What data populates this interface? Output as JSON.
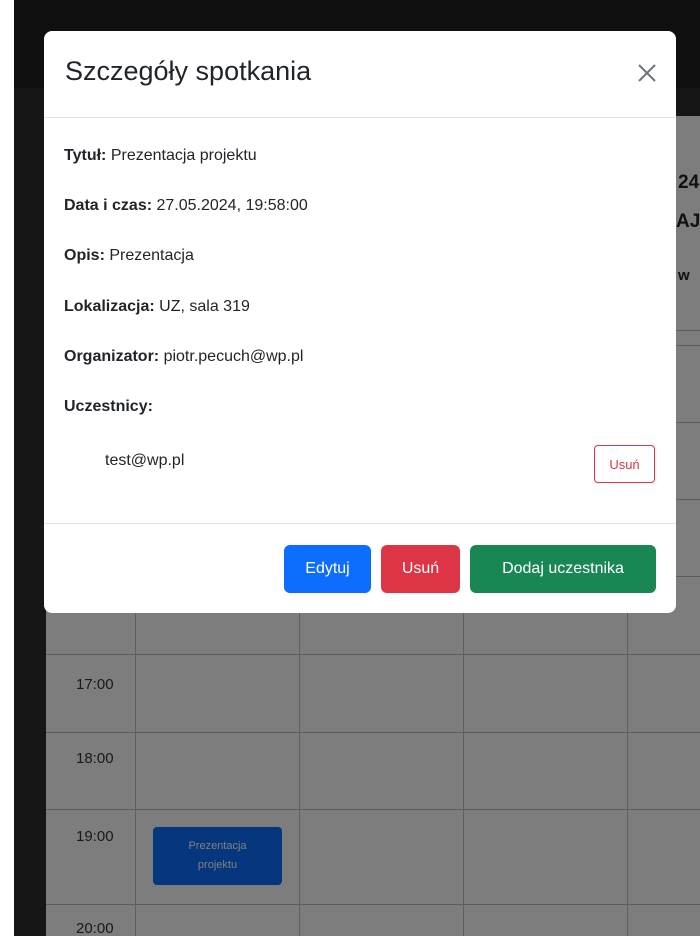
{
  "modal": {
    "title": "Szczegóły spotkania",
    "details": [
      {
        "label": "Tytuł:",
        "value": "Prezentacja projektu"
      },
      {
        "label": "Data i czas:",
        "value": "27.05.2024, 19:58:00"
      },
      {
        "label": "Opis:",
        "value": "Prezentacja"
      },
      {
        "label": "Lokalizacja:",
        "value": "UZ, sala 319"
      },
      {
        "label": "Organizator:",
        "value": "piotr.pecuch@wp.pl"
      }
    ],
    "participants_label": "Uczestnicy:",
    "participants": [
      {
        "email": "test@wp.pl",
        "remove_label": "Usuń"
      }
    ],
    "footer": {
      "edit_label": "Edytuj",
      "delete_label": "Usuń",
      "add_participant_label": "Dodaj uczestnika"
    }
  },
  "calendar": {
    "header_fragments": [
      "24",
      "AJ",
      "w"
    ],
    "hours": [
      "17:00",
      "18:00",
      "19:00",
      "20:00"
    ],
    "event": {
      "title": "Prezentacja projektu"
    }
  },
  "colors": {
    "primary": "#0d6efd",
    "danger": "#dc3545",
    "success": "#198754",
    "navbar": "#1f1f1f"
  }
}
